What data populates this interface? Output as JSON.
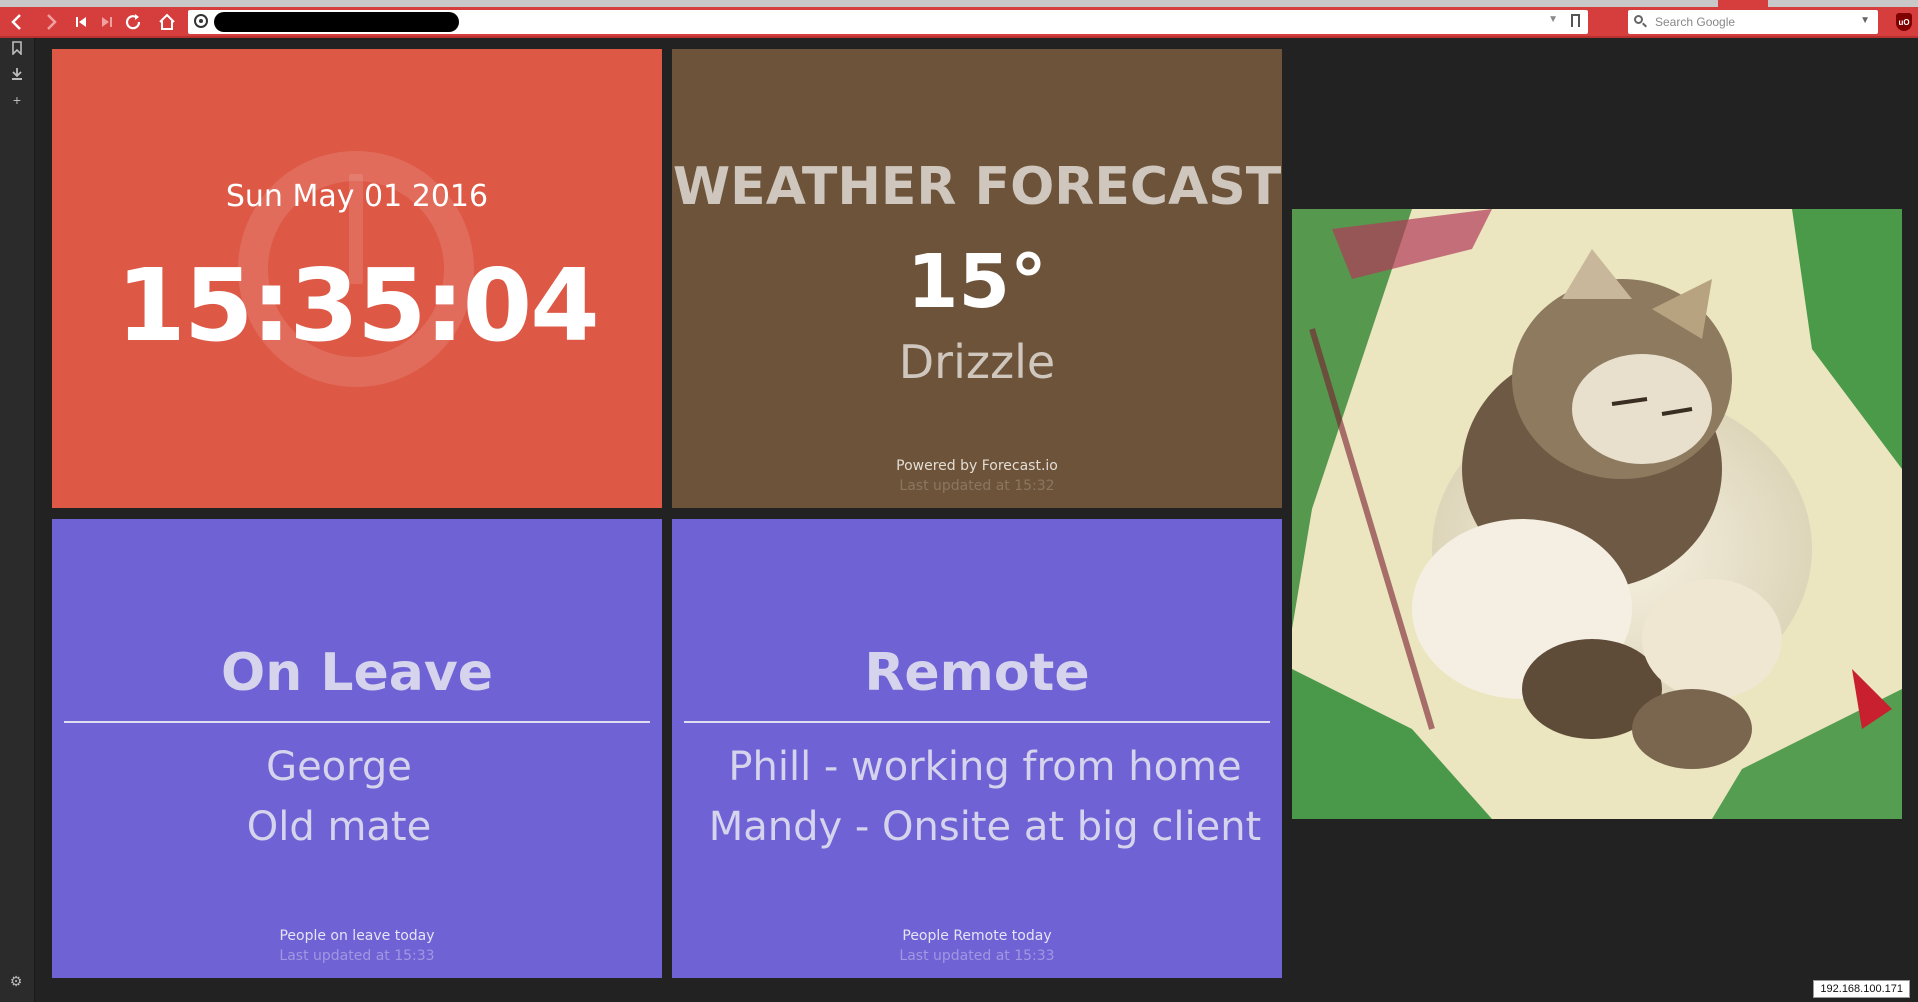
{
  "browser": {
    "search_placeholder": "Search Google",
    "addon_label": "uO",
    "status_ip": "192.168.100.171"
  },
  "clock": {
    "date": "Sun May 01 2016",
    "time": "15:35:04"
  },
  "weather": {
    "title": "WEATHER FORECAST",
    "temperature": "15°",
    "condition": "Drizzle",
    "footer": "Powered by Forecast.io",
    "updated": "Last updated at 15:32"
  },
  "on_leave": {
    "title": "On Leave",
    "people": [
      "George",
      "Old mate"
    ],
    "footer": "People on leave today",
    "updated": "Last updated at 15:33"
  },
  "remote": {
    "title": "Remote",
    "people": [
      "Phill - working from home",
      "Mandy - Onsite at big client"
    ],
    "footer": "People Remote today",
    "updated": "Last updated at 15:33"
  },
  "colors": {
    "clock_bg": "#dd5845",
    "weather_bg": "#6c533a",
    "people_bg": "#6f62d5",
    "browser_accent": "#d63d3d",
    "page_bg": "#222222"
  },
  "icons": {
    "back": "back-arrow-icon",
    "forward": "forward-arrow-icon",
    "rewind": "rewind-icon",
    "fastforward": "fastforward-icon",
    "reload": "reload-icon",
    "home": "home-icon",
    "bookmarks": "bookmarks-icon",
    "downloads": "downloads-icon",
    "add_panel": "plus-icon",
    "settings": "gear-icon"
  }
}
